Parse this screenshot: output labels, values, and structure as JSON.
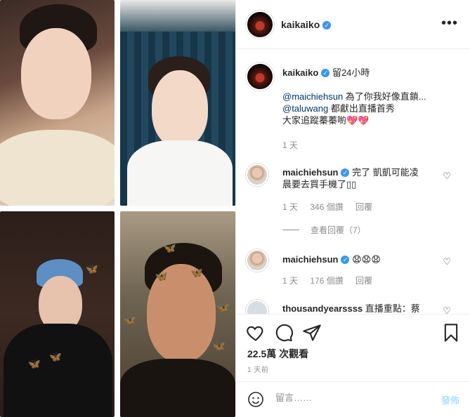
{
  "post": {
    "username": "kaikaiko",
    "more_label": "•••"
  },
  "caption": {
    "username": "kaikaiko",
    "text_after_name": "留24小時",
    "line1_mention": "@maichiehsun",
    "line1_text": " 為了你我好像直鎖...",
    "line2_mention": "@taluwang",
    "line2_text": " 都獻出直播首秀",
    "line3": "大家追蹤蓁蓁喲💖💖",
    "time": "1 天"
  },
  "comments": [
    {
      "username": "maichiehsun",
      "text_inline": "完了 凱凱可能凌",
      "text_line2": "晨要去買手機了▯▯",
      "time": "1 天",
      "likes": "346 個讚",
      "reply": "回覆",
      "view_replies": "查看回覆（7）"
    },
    {
      "username": "maichiehsun",
      "text_inline": "😧😧😧",
      "time": "1 天",
      "likes": "176 個讚",
      "reply": "回覆"
    },
    {
      "username": "thousandyearssss",
      "text_inline": "直播重點：蔡"
    }
  ],
  "actions": {
    "views": "22.5萬 次觀看",
    "posted": "1 天前"
  },
  "composer": {
    "placeholder": "留言……",
    "post_label": "發佈"
  },
  "colors": {
    "link": "#00376b",
    "verified": "#3897f0",
    "post_disabled": "#b2dffc",
    "meta": "#8e8e8e"
  },
  "icons": [
    "more-icon",
    "verified-icon",
    "heart-icon",
    "comment-icon",
    "share-icon",
    "save-icon",
    "emoji-icon"
  ]
}
